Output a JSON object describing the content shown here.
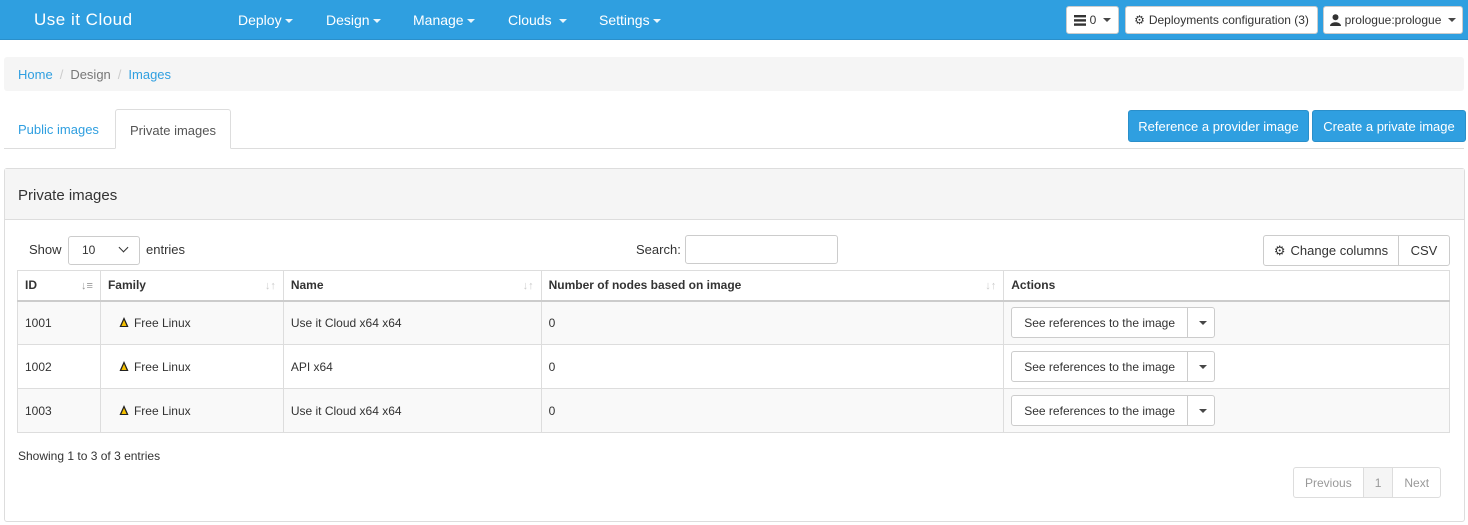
{
  "navbar": {
    "brand": "Use it Cloud",
    "menu": [
      {
        "label": "Deploy"
      },
      {
        "label": "Design"
      },
      {
        "label": "Manage"
      },
      {
        "label": "Clouds"
      },
      {
        "label": "Settings"
      }
    ],
    "tasks_count": "0",
    "deployments_config": "Deployments configuration (3)",
    "user": "prologue:prologue"
  },
  "breadcrumb": {
    "home": "Home",
    "design": "Design",
    "current": "Images"
  },
  "tabs": {
    "public": "Public images",
    "private": "Private images"
  },
  "actions": {
    "reference": "Reference a provider image",
    "create": "Create a private image"
  },
  "panel": {
    "title": "Private images"
  },
  "table_controls": {
    "show": "Show",
    "page_size": "10",
    "entries": "entries",
    "search_label": "Search:",
    "search_value": "",
    "change_columns": "Change columns",
    "csv": "CSV"
  },
  "table": {
    "headers": [
      "ID",
      "Family",
      "Name",
      "Number of nodes based on image",
      "Actions"
    ],
    "rows": [
      {
        "id": "1001",
        "family": "Free Linux",
        "name": "Use it Cloud x64 x64",
        "nodes": "0",
        "action": "See references to the image"
      },
      {
        "id": "1002",
        "family": "Free Linux",
        "name": "API x64",
        "nodes": "0",
        "action": "See references to the image"
      },
      {
        "id": "1003",
        "family": "Free Linux",
        "name": "Use it Cloud x64 x64",
        "nodes": "0",
        "action": "See references to the image"
      }
    ]
  },
  "footer": {
    "info": "Showing 1 to 3 of 3 entries",
    "previous": "Previous",
    "page": "1",
    "next": "Next"
  },
  "colors": {
    "primary": "#2f9fe0",
    "border": "#dddddd",
    "stripe": "#f9f9f9"
  },
  "icons": [
    "tasks-icon",
    "gear-icon",
    "user-icon",
    "linux-icon",
    "sort-icon",
    "caret-down-icon"
  ]
}
